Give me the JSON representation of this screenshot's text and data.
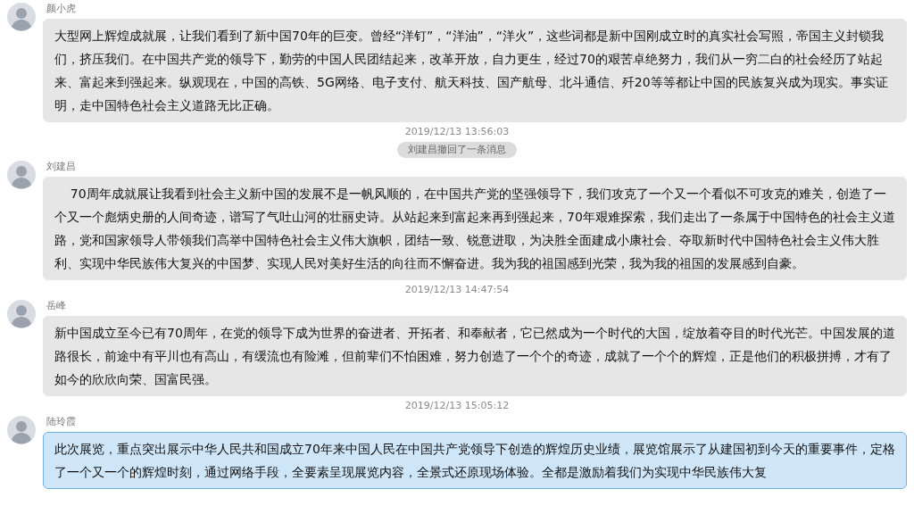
{
  "messages": [
    {
      "kind": "message",
      "sender": "颜小虎",
      "text": "大型网上辉煌成就展，让我们看到了新中国70年的巨变。曾经“洋钉”，“洋油”，“洋火”，这些词都是新中国刚成立时的真实社会写照，帝国主义封锁我们，挤压我们。在中国共产党的领导下，勤劳的中国人民团结起来，改革开放，自力更生，经过70的艰苦卓绝努力，我们从一穷二白的社会经历了站起来、富起来到强起来。纵观现在，中国的高铁、5G网络、电子支付、航天科技、国产航母、北斗通信、歼20等等都让中国的民族复兴成为现实。事实证明，走中国特色社会主义道路无比正确。",
      "selected": false
    },
    {
      "kind": "timestamp",
      "text": "2019/12/13 13:56:03"
    },
    {
      "kind": "notice",
      "text": "刘建昌撤回了一条消息"
    },
    {
      "kind": "message",
      "sender": "刘建昌",
      "text": "    70周年成就展让我看到社会主义新中国的发展不是一帆风顺的，在中国共产党的坚强领导下，我们攻克了一个又一个看似不可攻克的难关，创造了一个又一个彪炳史册的人间奇迹，谱写了气吐山河的壮丽史诗。从站起来到富起来再到强起来，70年艰难探索，我们走出了一条属于中国特色的社会主义道路，党和国家领导人带领我们高举中国特色社会主义伟大旗帜，团结一致、锐意进取，为决胜全面建成小康社会、夺取新时代中国特色社会主义伟大胜利、实现中华民族伟大复兴的中国梦、实现人民对美好生活的向往而不懈奋进。我为我的祖国感到光荣，我为我的祖国的发展感到自豪。",
      "selected": false
    },
    {
      "kind": "timestamp",
      "text": "2019/12/13 14:47:54"
    },
    {
      "kind": "message",
      "sender": "岳峰",
      "text": "新中国成立至今已有70周年，在党的领导下成为世界的奋进者、开拓者、和奉献者，它已然成为一个时代的大国，绽放着夺目的时代光芒。中国发展的道路很长，前途中有平川也有高山，有缓流也有险滩，但前辈们不怕困难，努力创造了一个个的奇迹，成就了一个个的辉煌，正是他们的积极拼搏，才有了如今的欣欣向荣、国富民强。",
      "selected": false
    },
    {
      "kind": "timestamp",
      "text": "2019/12/13 15:05:12"
    },
    {
      "kind": "message",
      "sender": "陆玲霞",
      "text": "此次展览，重点突出展示中华人民共和国成立70年来中国人民在中国共产党领导下创造的辉煌历史业绩，展览馆展示了从建国初到今天的重要事件，定格了一个又一个的辉煌时刻，通过网络手段，全要素呈现展览内容，全景式还原现场体验。全都是激励着我们为实现中华民族伟大复",
      "selected": true
    }
  ]
}
